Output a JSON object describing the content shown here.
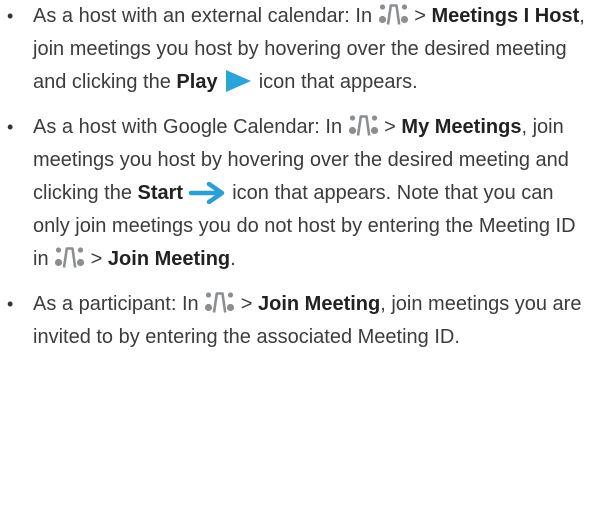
{
  "colors": {
    "text": "#3c3c3c",
    "bold_text": "#222222",
    "icon_gray": "#8a8f92",
    "play_blue": "#2aa3d8",
    "arrow_blue": "#2a9fd6"
  },
  "icons": {
    "app": "app-logo-icon",
    "play": "play-icon",
    "start_arrow": "arrow-right-icon"
  },
  "items": [
    {
      "p1": "As a host with an external calendar: In ",
      "p2": " > ",
      "b1": "Meetings I Host",
      "p3": ", join meetings you host by hovering over the desired meeting and clicking the ",
      "b2": "Play",
      "p4": " icon that appears."
    },
    {
      "p1": "As a host with Google Calendar: In ",
      "p2": " > ",
      "b1": "My Meetings",
      "p3": ", join meetings you host by hovering over the desired meeting and clicking the ",
      "b2": "Start",
      "p4": " icon that appears. Note that you can only join meetings you do not host by entering the Meeting ID in ",
      "p5": " > ",
      "b3": "Join Meeting",
      "p6": "."
    },
    {
      "p1": "As a participant: In ",
      "p2": " > ",
      "b1": "Join Meeting",
      "p3": ", join meetings you are invited to by entering the associated Meeting ID."
    }
  ]
}
